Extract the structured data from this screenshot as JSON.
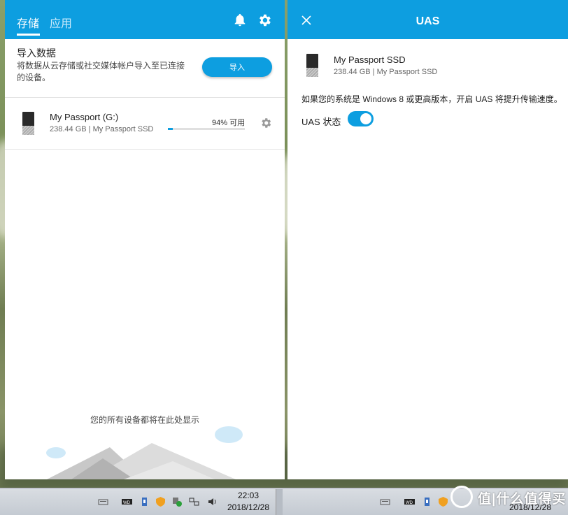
{
  "left_panel": {
    "tabs": [
      {
        "label": "存储"
      },
      {
        "label": "应用"
      }
    ],
    "import": {
      "title": "导入数据",
      "description": "将数据从云存储或社交媒体帐户导入至已连接的设备。",
      "button_label": "导入"
    },
    "device": {
      "name": "My Passport (G:)",
      "details": "238.44 GB | My Passport SSD",
      "available_label": "94% 可用",
      "available_percent": 94
    },
    "empty_message": "您的所有设备都将在此处显示"
  },
  "right_panel": {
    "title": "UAS",
    "device": {
      "name": "My Passport SSD",
      "details": "238.44 GB | My Passport SSD"
    },
    "description": "如果您的系统是 Windows 8 或更高版本，开启 UAS 将提升传输速度。",
    "uas_label": "UAS 状态",
    "uas_enabled": true
  },
  "taskbar": {
    "time": "22:03",
    "date": "2018/12/28",
    "date_right": "2018/12/28"
  },
  "watermark": {
    "text": "值|什么值得买"
  },
  "colors": {
    "accent": "#0d9ee0",
    "header_text": "#ffffff"
  }
}
